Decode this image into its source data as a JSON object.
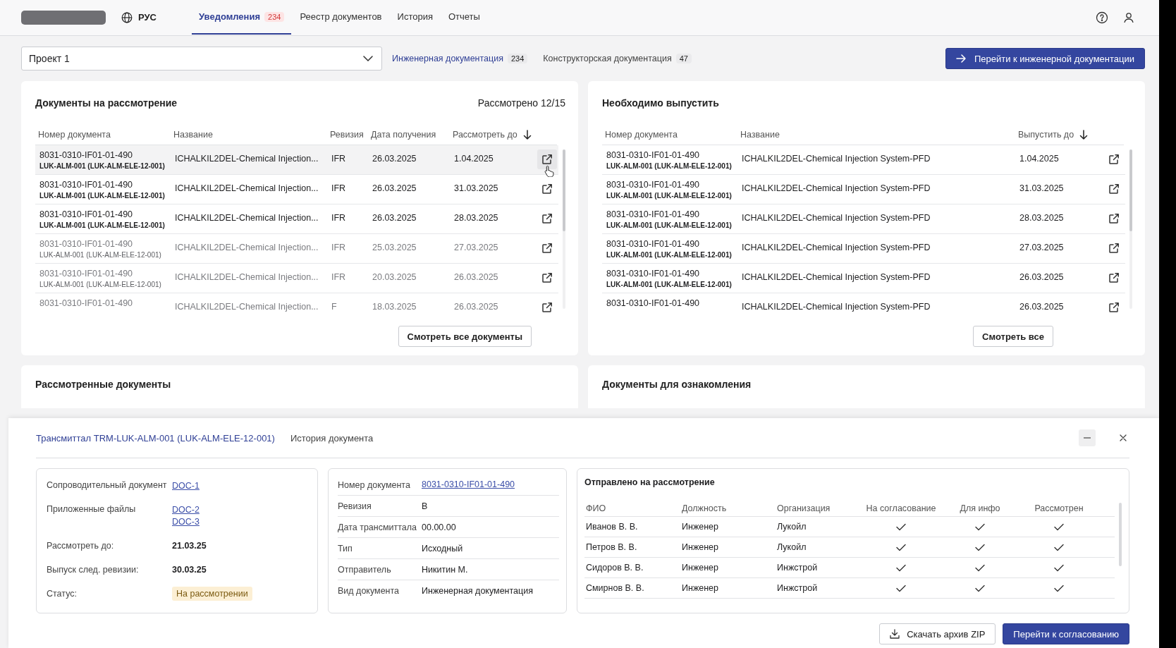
{
  "nav": {
    "language": "РУС",
    "tabs": [
      {
        "label": "Уведомления",
        "badge": "234",
        "selected": true
      },
      {
        "label": "Реестр документов",
        "selected": false
      },
      {
        "label": "История",
        "selected": false
      },
      {
        "label": "Отчеты",
        "selected": false
      }
    ]
  },
  "toolbar": {
    "project": "Проект 1",
    "doc_tabs": [
      {
        "label": "Инженерная документация",
        "count": "234",
        "selected": true
      },
      {
        "label": "Конструкторская документация",
        "count": "47",
        "selected": false
      }
    ],
    "action": "Перейти к инженерной документации"
  },
  "review_card": {
    "title": "Документы на рассмотрение",
    "summary": "Рассмотрено 12/15",
    "columns": [
      {
        "label": "Номер документа",
        "sorted": false
      },
      {
        "label": "Название",
        "sorted": false
      },
      {
        "label": "Ревизия",
        "sorted": false
      },
      {
        "label": "Дата получения",
        "sorted": false
      },
      {
        "label": "Рассмотреть до",
        "sorted": true
      }
    ],
    "rows": [
      {
        "number": "8031-0310-IF01-01-490",
        "code": "LUK-ALM-001 (LUK-ALM-ELE-12-001)",
        "name": "ICHALKIL2DEL-Chemical Injection...",
        "revision": "IFR",
        "received": "26.03.2025",
        "due": "1.04.2025",
        "dimmed": false,
        "highlighted": true
      },
      {
        "number": "8031-0310-IF01-01-490",
        "code": "LUK-ALM-001 (LUK-ALM-ELE-12-001)",
        "name": "ICHALKIL2DEL-Chemical Injection...",
        "revision": "IFR",
        "received": "26.03.2025",
        "due": "31.03.2025",
        "dimmed": false,
        "highlighted": false
      },
      {
        "number": "8031-0310-IF01-01-490",
        "code": "LUK-ALM-001 (LUK-ALM-ELE-12-001)",
        "name": "ICHALKIL2DEL-Chemical Injection...",
        "revision": "IFR",
        "received": "26.03.2025",
        "due": "28.03.2025",
        "dimmed": false,
        "highlighted": false
      },
      {
        "number": "8031-0310-IF01-01-490",
        "code": "LUK-ALM-001 (LUK-ALM-ELE-12-001)",
        "name": "ICHALKIL2DEL-Chemical Injection...",
        "revision": "IFR",
        "received": "25.03.2025",
        "due": "27.03.2025",
        "dimmed": true,
        "highlighted": false
      },
      {
        "number": "8031-0310-IF01-01-490",
        "code": "LUK-ALM-001 (LUK-ALM-ELE-12-001)",
        "name": "ICHALKIL2DEL-Chemical Injection...",
        "revision": "IFR",
        "received": "20.03.2025",
        "due": "26.03.2025",
        "dimmed": true,
        "highlighted": false
      },
      {
        "number": "8031-0310-IF01-01-490",
        "name": "ICHALKIL2DEL-Chemical Injection...",
        "revision": "F",
        "received": "18.03.2025",
        "due": "26.03.2025",
        "dimmed": true,
        "highlighted": false
      }
    ],
    "button": "Смотреть все документы"
  },
  "release_card": {
    "title": "Необходимо выпустить",
    "columns": [
      {
        "label": "Номер документа",
        "sorted": false
      },
      {
        "label": "Название",
        "sorted": false
      },
      {
        "label": "Выпустить до",
        "sorted": true
      }
    ],
    "rows": [
      {
        "number": "8031-0310-IF01-01-490",
        "code": "LUK-ALM-001 (LUK-ALM-ELE-12-001)",
        "name": "ICHALKIL2DEL-Chemical Injection System-PFD",
        "due": "1.04.2025"
      },
      {
        "number": "8031-0310-IF01-01-490",
        "code": "LUK-ALM-001 (LUK-ALM-ELE-12-001)",
        "name": "ICHALKIL2DEL-Chemical Injection System-PFD",
        "due": "31.03.2025"
      },
      {
        "number": "8031-0310-IF01-01-490",
        "code": "LUK-ALM-001 (LUK-ALM-ELE-12-001)",
        "name": "ICHALKIL2DEL-Chemical Injection System-PFD",
        "due": "28.03.2025"
      },
      {
        "number": "8031-0310-IF01-01-490",
        "code": "LUK-ALM-001 (LUK-ALM-ELE-12-001)",
        "name": "ICHALKIL2DEL-Chemical Injection System-PFD",
        "due": "27.03.2025"
      },
      {
        "number": "8031-0310-IF01-01-490",
        "code": "LUK-ALM-001 (LUK-ALM-ELE-12-001)",
        "name": "ICHALKIL2DEL-Chemical Injection System-PFD",
        "due": "26.03.2025"
      },
      {
        "number": "8031-0310-IF01-01-490",
        "name": "ICHALKIL2DEL-Chemical Injection System-PFD",
        "due": "26.03.2025"
      }
    ],
    "button": "Смотреть все"
  },
  "lower_cards": [
    {
      "title": "Рассмотренные документы"
    },
    {
      "title": "Документы для ознакомления"
    }
  ],
  "panel": {
    "tabs": [
      {
        "label": "Трансмиттал TRM-LUK-ALM-001 (LUK-ALM-ELE-12-001)",
        "selected": true
      },
      {
        "label": "История документа",
        "selected": false
      }
    ],
    "summary": [
      {
        "kind": "links",
        "label": "Сопроводительный документ",
        "links": [
          "DOC-1"
        ]
      },
      {
        "kind": "links",
        "label": "Приложенные файлы",
        "links": [
          "DOC-2",
          "DOC-3"
        ]
      },
      {
        "kind": "value",
        "label": "Рассмотреть до:",
        "value": "21.03.25"
      },
      {
        "kind": "value",
        "label": "Выпуск след. ревизии:",
        "value": "30.03.25"
      },
      {
        "kind": "status",
        "label": "Статус:",
        "value": "На рассмотрении"
      }
    ],
    "details": [
      {
        "kind": "link",
        "label": "Номер документа",
        "value": "8031-0310-IF01-01-490"
      },
      {
        "kind": "text",
        "label": "Ревизия",
        "value": "B"
      },
      {
        "kind": "text",
        "label": "Дата трансмиттала",
        "value": "00.00.00"
      },
      {
        "kind": "text",
        "label": "Тип",
        "value": "Исходный"
      },
      {
        "kind": "text",
        "label": "Отправитель",
        "value": "Никитин М."
      },
      {
        "kind": "text",
        "label": "Вид документа",
        "value": "Инженерная документация"
      }
    ],
    "recipients": {
      "title": "Отправлено на рассмотрение",
      "columns": [
        "ФИО",
        "Должность",
        "Организация",
        "На согласование",
        "Для инфо",
        "Рассмотрен"
      ],
      "rows": [
        {
          "name": "Иванов В. В.",
          "position": "Инженер",
          "organization": "Лукойл",
          "approval": true,
          "info": true,
          "reviewed": true
        },
        {
          "name": "Петров В. В.",
          "position": "Инженер",
          "organization": "Лукойл",
          "approval": true,
          "info": true,
          "reviewed": true
        },
        {
          "name": "Сидоров В. В.",
          "position": "Инженер",
          "organization": "Инжстрой",
          "approval": true,
          "info": true,
          "reviewed": true
        },
        {
          "name": "Смирнов В. В.",
          "position": "Инженер",
          "organization": "Инжстрой",
          "approval": true,
          "info": true,
          "reviewed": true
        }
      ]
    },
    "buttons": [
      {
        "kind": "secondary",
        "label": "Скачать архив ZIP"
      },
      {
        "kind": "primary",
        "label": "Перейти к согласованию"
      }
    ]
  }
}
